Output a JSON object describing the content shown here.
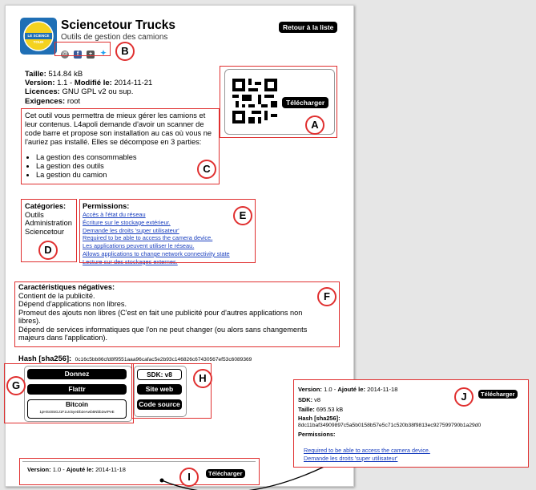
{
  "app": {
    "title": "Sciencetour Trucks",
    "subtitle": "Outils de gestion des camions",
    "logo_text": "LE SCIENCE TOUR",
    "back_button": "Retour à la liste"
  },
  "social": [
    "email-icon",
    "facebook-icon",
    "googleplus-icon",
    "twitter-icon"
  ],
  "info": {
    "size_label": "Taille:",
    "size_value": "514.84 kB",
    "version_label": "Version:",
    "version_value": "1.1",
    "modified_label": "Modifié le:",
    "modified_value": "2014-11-21",
    "licence_label": "Licences:",
    "licence_value": "GNU GPL v2 ou sup.",
    "req_label": "Exigences:",
    "req_value": "root"
  },
  "qr": {
    "download_label": "Télécharger"
  },
  "description": {
    "text": "Cet outil vous permettra de mieux gérer les camions et leur contenus. L4apoli demande d'avoir un scanner de code barre et propose son installation au cas où vous ne l'auriez pas installé. Elles se décompose en 3 parties:",
    "bullets": [
      "La gestion des consommables",
      "La gestion des outils",
      "La gestion du camion"
    ]
  },
  "categories": {
    "title": "Catégories:",
    "items": [
      "Outils",
      "Administration",
      "Sciencetour"
    ]
  },
  "permissions": {
    "title": "Permissions:",
    "items": [
      "Accès à l'état du réseau",
      "Écriture sur le stockage extérieur.",
      "Demande les droits 'super utilisateur'",
      "Required to be able to access the camera device.",
      "Les applications peuvent utiliser le réseau.",
      "Allows applications to change network connectivity state",
      "Lecture sur des stockages externes."
    ]
  },
  "negatives": {
    "title": "Caractéristiques négatives:",
    "lines": [
      "Contient de la publicité.",
      "Dépend d'applications non libres.",
      "Promeut des ajouts non libres (C'est en fait une publicité pour d'autres applications non libres).",
      "Dépend de services informatiques que l'on ne peut changer (ou alors sans changements majeurs dans l'application)."
    ]
  },
  "hash": {
    "label": "Hash [sha256]:",
    "value": "0c16c5bb86cfd8f9551aaa96cafac5e2b93c146826c67430567ef53c6089369"
  },
  "donate": {
    "donnez": "Donnez",
    "flattr": "Flattr",
    "bitcoin_label": "Bitcoin",
    "bitcoin_addr": "1pHS4S5GJ1F1Uc5yeDb2eAwb5Nbb2wrPeE"
  },
  "sdk": {
    "sdk": "SDK: v8",
    "site": "Site web",
    "source": "Code source"
  },
  "bottom_version": {
    "version_label": "Version:",
    "version_value": "1.0",
    "added_label": "Ajouté le:",
    "added_value": "2014-11-18",
    "download": "Télécharger"
  },
  "expanded": {
    "version_label": "Version:",
    "version_value": "1.0",
    "added_label": "Ajouté le:",
    "added_value": "2014-11-18",
    "download": "Télécharger",
    "sdk_label": "SDK:",
    "sdk_value": "v8",
    "size_label": "Taille:",
    "size_value": "695.53 kB",
    "hash_label": "Hash [sha256]:",
    "hash_value": "8dc11baf34909897c5a5b0158b57e5c71c520b38f9813ec927599790b1a29d0",
    "perm_title": "Permissions:",
    "perms": [
      "Required to be able to access the camera device.",
      "Demande les droits 'super utilisateur'"
    ]
  },
  "markers": [
    "A",
    "B",
    "C",
    "D",
    "E",
    "F",
    "G",
    "H",
    "I",
    "J"
  ],
  "colors": {
    "annotation": "#e03030",
    "link": "#1a3fbf",
    "button": "#000000"
  }
}
